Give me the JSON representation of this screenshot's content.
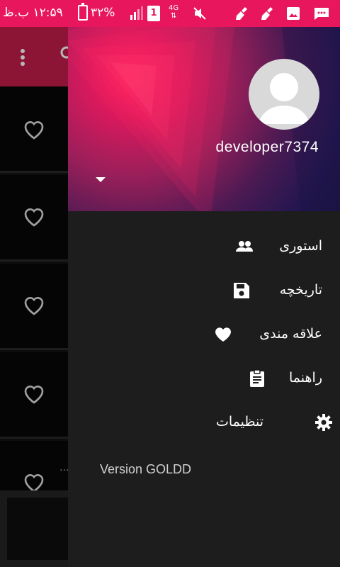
{
  "status_bar": {
    "time": "۱۲:۵۹ ب.ظ",
    "battery": "۳۲%",
    "network": "4G",
    "sim": "1",
    "icons": [
      "battery-charging-icon",
      "signal-icon",
      "sim-icon",
      "network-4g-icon",
      "mute-icon",
      "cleaner-icon",
      "cleaner-icon",
      "gallery-icon",
      "message-icon"
    ],
    "color": "#e8175d"
  },
  "drawer": {
    "username": "developer7374",
    "menu": [
      {
        "label": "استوری",
        "icon": "people-icon"
      },
      {
        "label": "تاریخچه",
        "icon": "save-icon"
      },
      {
        "label": "علاقه مندی",
        "icon": "heart-icon"
      },
      {
        "label": "راهنما",
        "icon": "clipboard-icon"
      },
      {
        "label": "تنظیمات",
        "icon": "gear-icon"
      }
    ],
    "version": "Version GOLDD"
  },
  "background_app": {
    "toolbar_color": "#8c1434",
    "rows": 5,
    "overflow_text": "..."
  }
}
